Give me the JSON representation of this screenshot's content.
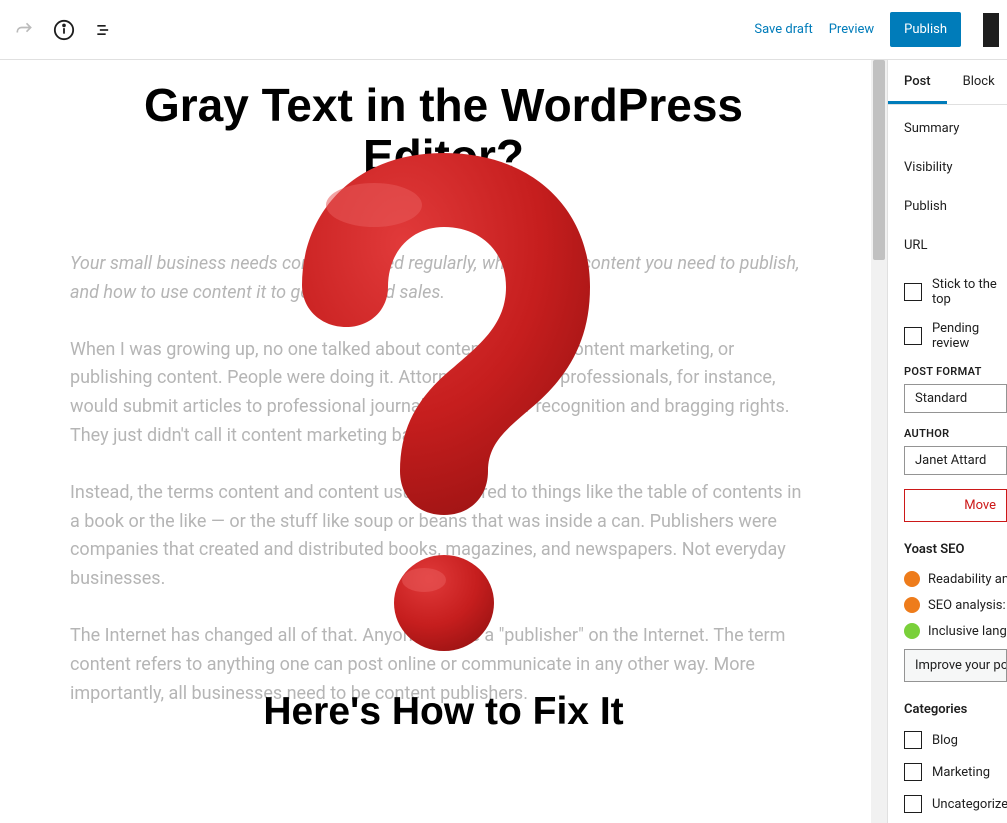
{
  "topbar": {
    "save_draft": "Save draft",
    "preview": "Preview",
    "publish": "Publish"
  },
  "editor": {
    "headline": "Gray Text in the WordPress Editor?",
    "subhead": "Here's How to Fix It",
    "paragraphs": {
      "intro": "Your small business needs content created regularly, what kind of content you need to publish, and how to use content it to get leads and sales.",
      "p1": "When I was growing up, no one talked about content creation, content marketing, or publishing content. People were doing it. Attorneys and other professionals, for instance, would submit articles to professional journals for the peer recognition and bragging rights. They just didn't call it content marketing back then.)",
      "p2": "Instead, the terms content and content usually referred to things like the table of contents in a book or the like — or the stuff like soup or beans that was inside a can. Publishers were companies that created and distributed books, magazines, and newspapers. Not everyday businesses.",
      "p3": "The Internet has changed all of that. Anyone can be a \"publisher\" on the Internet. The term content refers to anything one can post online or communicate in any other way. More importantly, all businesses need to be content publishers."
    }
  },
  "sidebar": {
    "tabs": {
      "post": "Post",
      "block": "Block"
    },
    "summary": "Summary",
    "visibility": "Visibility",
    "publish": "Publish",
    "url": "URL",
    "stick": "Stick to the top",
    "pending": "Pending review",
    "post_format_label": "POST FORMAT",
    "post_format_value": "Standard",
    "author_label": "AUTHOR",
    "author_value": "Janet Attard",
    "move": "Move",
    "yoast": "Yoast SEO",
    "readability": "Readability analysis",
    "seo_ok": "SEO analysis: OK",
    "inclusive": "Inclusive language",
    "improve": "Improve your post",
    "categories": "Categories",
    "cat_blog": "Blog",
    "cat_marketing": "Marketing",
    "cat_uncat": "Uncategorized"
  }
}
